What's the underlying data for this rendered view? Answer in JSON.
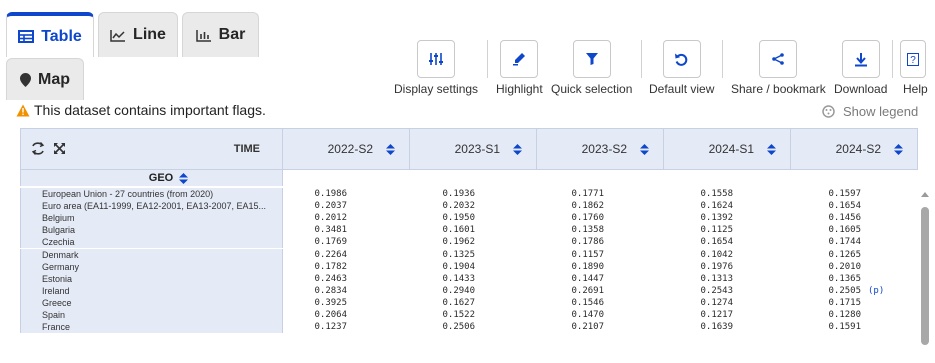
{
  "tabs": [
    {
      "label": "Table",
      "active": true
    },
    {
      "label": "Line",
      "active": false
    },
    {
      "label": "Bar",
      "active": false
    },
    {
      "label": "Map",
      "active": false
    }
  ],
  "toolbar": {
    "display_settings": "Display settings",
    "highlight": "Highlight",
    "quick_selection": "Quick selection",
    "default_view": "Default view",
    "share": "Share / bookmark",
    "download": "Download",
    "help": "Help"
  },
  "notice": "This dataset contains important flags.",
  "show_legend": "Show legend",
  "colors": {
    "accent": "#0e47cb",
    "warning": "#f29100",
    "header_bg": "#e4eaf6"
  },
  "table": {
    "time_label": "TIME",
    "geo_label": "GEO",
    "columns": [
      "2022-S2",
      "2023-S1",
      "2023-S2",
      "2024-S1",
      "2024-S2"
    ],
    "rows": [
      {
        "geo": "European Union - 27 countries (from 2020)",
        "values": [
          "0.1986",
          "0.1936",
          "0.1771",
          "0.1558",
          "0.1597"
        ]
      },
      {
        "geo": "Euro area (EA11-1999, EA12-2001, EA13-2007, EA15...",
        "values": [
          "0.2037",
          "0.2032",
          "0.1862",
          "0.1624",
          "0.1654"
        ]
      },
      {
        "geo": "Belgium",
        "values": [
          "0.2012",
          "0.1950",
          "0.1760",
          "0.1392",
          "0.1456"
        ]
      },
      {
        "geo": "Bulgaria",
        "values": [
          "0.3481",
          "0.1601",
          "0.1358",
          "0.1125",
          "0.1605"
        ]
      },
      {
        "geo": "Czechia",
        "values": [
          "0.1769",
          "0.1962",
          "0.1786",
          "0.1654",
          "0.1744"
        ]
      },
      {
        "geo": "Denmark",
        "values": [
          "0.2264",
          "0.1325",
          "0.1157",
          "0.1042",
          "0.1265"
        ]
      },
      {
        "geo": "Germany",
        "values": [
          "0.1782",
          "0.1904",
          "0.1890",
          "0.1976",
          "0.2010"
        ]
      },
      {
        "geo": "Estonia",
        "values": [
          "0.2463",
          "0.1433",
          "0.1447",
          "0.1313",
          "0.1365"
        ]
      },
      {
        "geo": "Ireland",
        "values": [
          "0.2834",
          "0.2940",
          "0.2691",
          "0.2543",
          "0.2505"
        ],
        "flag": "(p)"
      },
      {
        "geo": "Greece",
        "values": [
          "0.3925",
          "0.1627",
          "0.1546",
          "0.1274",
          "0.1715"
        ]
      },
      {
        "geo": "Spain",
        "values": [
          "0.2064",
          "0.1522",
          "0.1470",
          "0.1217",
          "0.1280"
        ]
      },
      {
        "geo": "France",
        "values": [
          "0.1237",
          "0.2506",
          "0.2107",
          "0.1639",
          "0.1591"
        ]
      }
    ]
  }
}
